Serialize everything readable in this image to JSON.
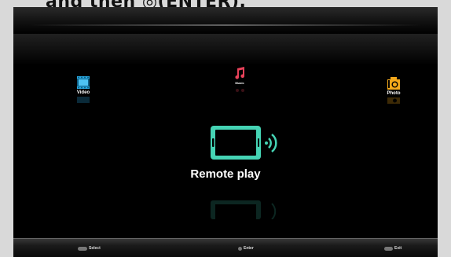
{
  "caption": {
    "text": "and then ◎(ENTER)."
  },
  "menu": {
    "items": [
      {
        "id": "video",
        "label": "Video",
        "icon": "film-icon",
        "color": "#29a9e1"
      },
      {
        "id": "music",
        "label": "Music",
        "icon": "music-note-icon",
        "color": "#e8425a"
      },
      {
        "id": "photo",
        "label": "Photo",
        "icon": "camera-icon",
        "color": "#f3a81b"
      }
    ],
    "selected": {
      "label": "Remote play",
      "icon": "phone-wireless-icon",
      "color": "#45d3b4"
    }
  },
  "footer": {
    "select_label": "Select",
    "enter_label": "Enter",
    "exit_label": "Exit"
  }
}
